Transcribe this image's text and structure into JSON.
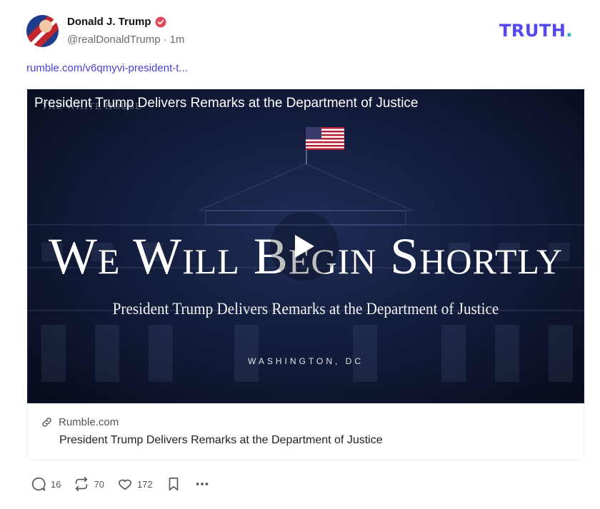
{
  "author": {
    "name": "Donald J. Trump",
    "handle": "@realDonaldTrump",
    "separator": "·",
    "timestamp": "1m"
  },
  "brand": {
    "logo_text": "TRUTH",
    "logo_dot": "."
  },
  "post": {
    "link_text": "rumble.com/v6qmyvi-president-t..."
  },
  "video": {
    "title": "President Trump Delivers Remarks at the Department of Justice",
    "watermark": "THE WHITE HOUSE",
    "headline": "We Will Begin Shortly",
    "subheadline": "President Trump Delivers Remarks at the Department of Justice",
    "location": "WASHINGTON, DC"
  },
  "link_card": {
    "domain": "Rumble.com",
    "title": "President Trump Delivers Remarks at the Department of Justice"
  },
  "actions": {
    "replies": "16",
    "retruths": "70",
    "likes": "172"
  },
  "colors": {
    "brand_purple": "#5448ee",
    "brand_teal": "#17b3b0",
    "link": "#4a3fd6",
    "verified": "#e0485a"
  }
}
